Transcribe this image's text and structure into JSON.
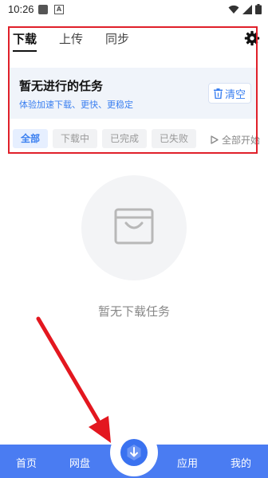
{
  "status_bar": {
    "time": "10:26",
    "notification_glyph": "A"
  },
  "tabs": [
    {
      "label": "下载",
      "active": true
    },
    {
      "label": "上传",
      "active": false
    },
    {
      "label": "同步",
      "active": false
    }
  ],
  "banner": {
    "title": "暂无进行的任务",
    "subtitle": "体验加速下载、更快、更稳定",
    "clear_label": "清空"
  },
  "filters": [
    {
      "label": "全部",
      "active": true
    },
    {
      "label": "下载中",
      "active": false
    },
    {
      "label": "已完成",
      "active": false
    },
    {
      "label": "已失败",
      "active": false
    }
  ],
  "start_all_label": "全部开始",
  "empty_text": "暂无下载任务",
  "bottom_nav": {
    "items": [
      "首页",
      "网盘",
      "应用",
      "我的"
    ]
  },
  "colors": {
    "accent": "#3a7ff0",
    "nav_bg": "#4a7cf2",
    "highlight": "#e0202a"
  },
  "icons": [
    "gear-icon",
    "trash-icon",
    "play-icon",
    "bag-icon",
    "download-icon",
    "wifi-icon",
    "signal-icon",
    "battery-icon"
  ]
}
